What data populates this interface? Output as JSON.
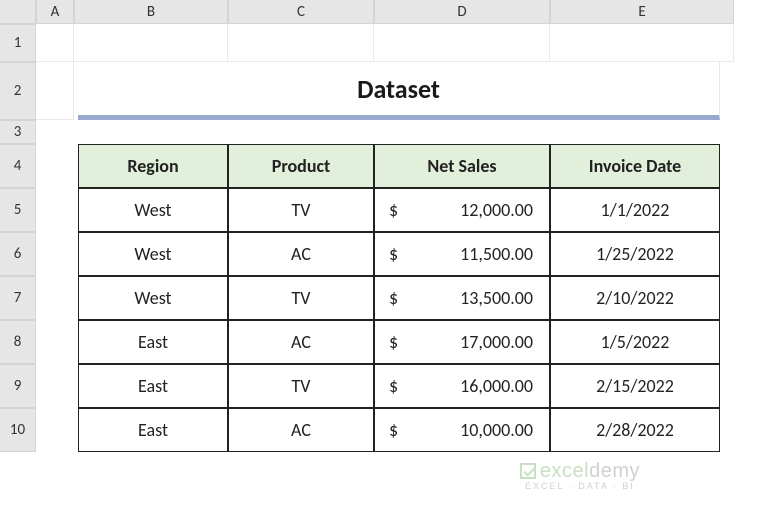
{
  "columns": [
    "A",
    "B",
    "C",
    "D",
    "E"
  ],
  "rows": [
    "1",
    "2",
    "3",
    "4",
    "5",
    "6",
    "7",
    "8",
    "9",
    "10"
  ],
  "title": "Dataset",
  "headers": {
    "region": "Region",
    "product": "Product",
    "netSales": "Net Sales",
    "invoiceDate": "Invoice Date"
  },
  "currency": "$",
  "data": [
    {
      "region": "West",
      "product": "TV",
      "netSales": "12,000.00",
      "invoiceDate": "1/1/2022"
    },
    {
      "region": "West",
      "product": "AC",
      "netSales": "11,500.00",
      "invoiceDate": "1/25/2022"
    },
    {
      "region": "West",
      "product": "TV",
      "netSales": "13,500.00",
      "invoiceDate": "2/10/2022"
    },
    {
      "region": "East",
      "product": "AC",
      "netSales": "17,000.00",
      "invoiceDate": "1/5/2022"
    },
    {
      "region": "East",
      "product": "TV",
      "netSales": "16,000.00",
      "invoiceDate": "2/15/2022"
    },
    {
      "region": "East",
      "product": "AC",
      "netSales": "10,000.00",
      "invoiceDate": "2/28/2022"
    }
  ],
  "watermark": {
    "brand_prefix": "excel",
    "brand_suffix": "demy",
    "tagline": "EXCEL · DATA · BI"
  }
}
